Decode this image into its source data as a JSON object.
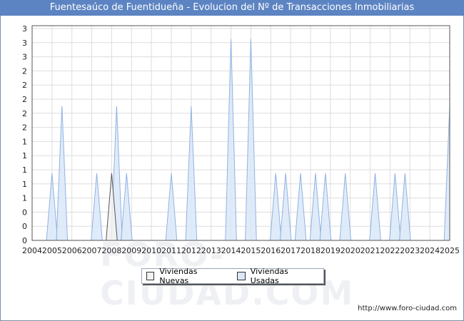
{
  "title": "Fuentesaúco de Fuentidueña - Evolucion del Nº de Transacciones Inmobiliarias",
  "watermark": "FORO-CIUDAD.COM",
  "source": "http://www.foro-ciudad.com",
  "colors": {
    "title_bg": "#5d84c2",
    "nuevas_fill": "#f2f2f2",
    "nuevas_stroke": "#555555",
    "usadas_fill": "#dbe8f8",
    "usadas_stroke": "#8fb3e3",
    "grid": "#dddddd"
  },
  "legend": {
    "nuevas": "Viviendas Nuevas",
    "usadas": "Viviendas Usadas"
  },
  "chart_data": {
    "type": "area",
    "x_tick_labels": [
      "2004",
      "2005",
      "2006",
      "2007",
      "2008",
      "2009",
      "2010",
      "2011",
      "2012",
      "2013",
      "2014",
      "2015",
      "2016",
      "2017",
      "2018",
      "2019",
      "2020",
      "2021",
      "2022",
      "2023",
      "2024",
      "2025"
    ],
    "y_tick_labels": [
      "0",
      "0",
      "0",
      "1",
      "1",
      "1",
      "1",
      "1",
      "2",
      "2",
      "2",
      "2",
      "2",
      "3",
      "3",
      "3"
    ],
    "ylim": [
      0,
      3.2
    ],
    "xlim": [
      2004,
      2025
    ],
    "grid": true,
    "legend_position": "bottom-center",
    "series": [
      {
        "name": "Viviendas Nuevas",
        "peaks": [
          {
            "x": 2008.0,
            "y": 1
          }
        ]
      },
      {
        "name": "Viviendas Usadas",
        "peaks": [
          {
            "x": 2005.0,
            "y": 1
          },
          {
            "x": 2005.5,
            "y": 2
          },
          {
            "x": 2007.25,
            "y": 1
          },
          {
            "x": 2008.25,
            "y": 2
          },
          {
            "x": 2008.75,
            "y": 1
          },
          {
            "x": 2011.0,
            "y": 1
          },
          {
            "x": 2012.0,
            "y": 2
          },
          {
            "x": 2014.0,
            "y": 3
          },
          {
            "x": 2015.0,
            "y": 3
          },
          {
            "x": 2016.25,
            "y": 1
          },
          {
            "x": 2016.75,
            "y": 1
          },
          {
            "x": 2017.5,
            "y": 1
          },
          {
            "x": 2018.25,
            "y": 1
          },
          {
            "x": 2018.75,
            "y": 1
          },
          {
            "x": 2019.75,
            "y": 1
          },
          {
            "x": 2021.25,
            "y": 1
          },
          {
            "x": 2022.25,
            "y": 1
          },
          {
            "x": 2022.75,
            "y": 1
          },
          {
            "x": 2025.0,
            "y": 2
          }
        ]
      }
    ]
  }
}
